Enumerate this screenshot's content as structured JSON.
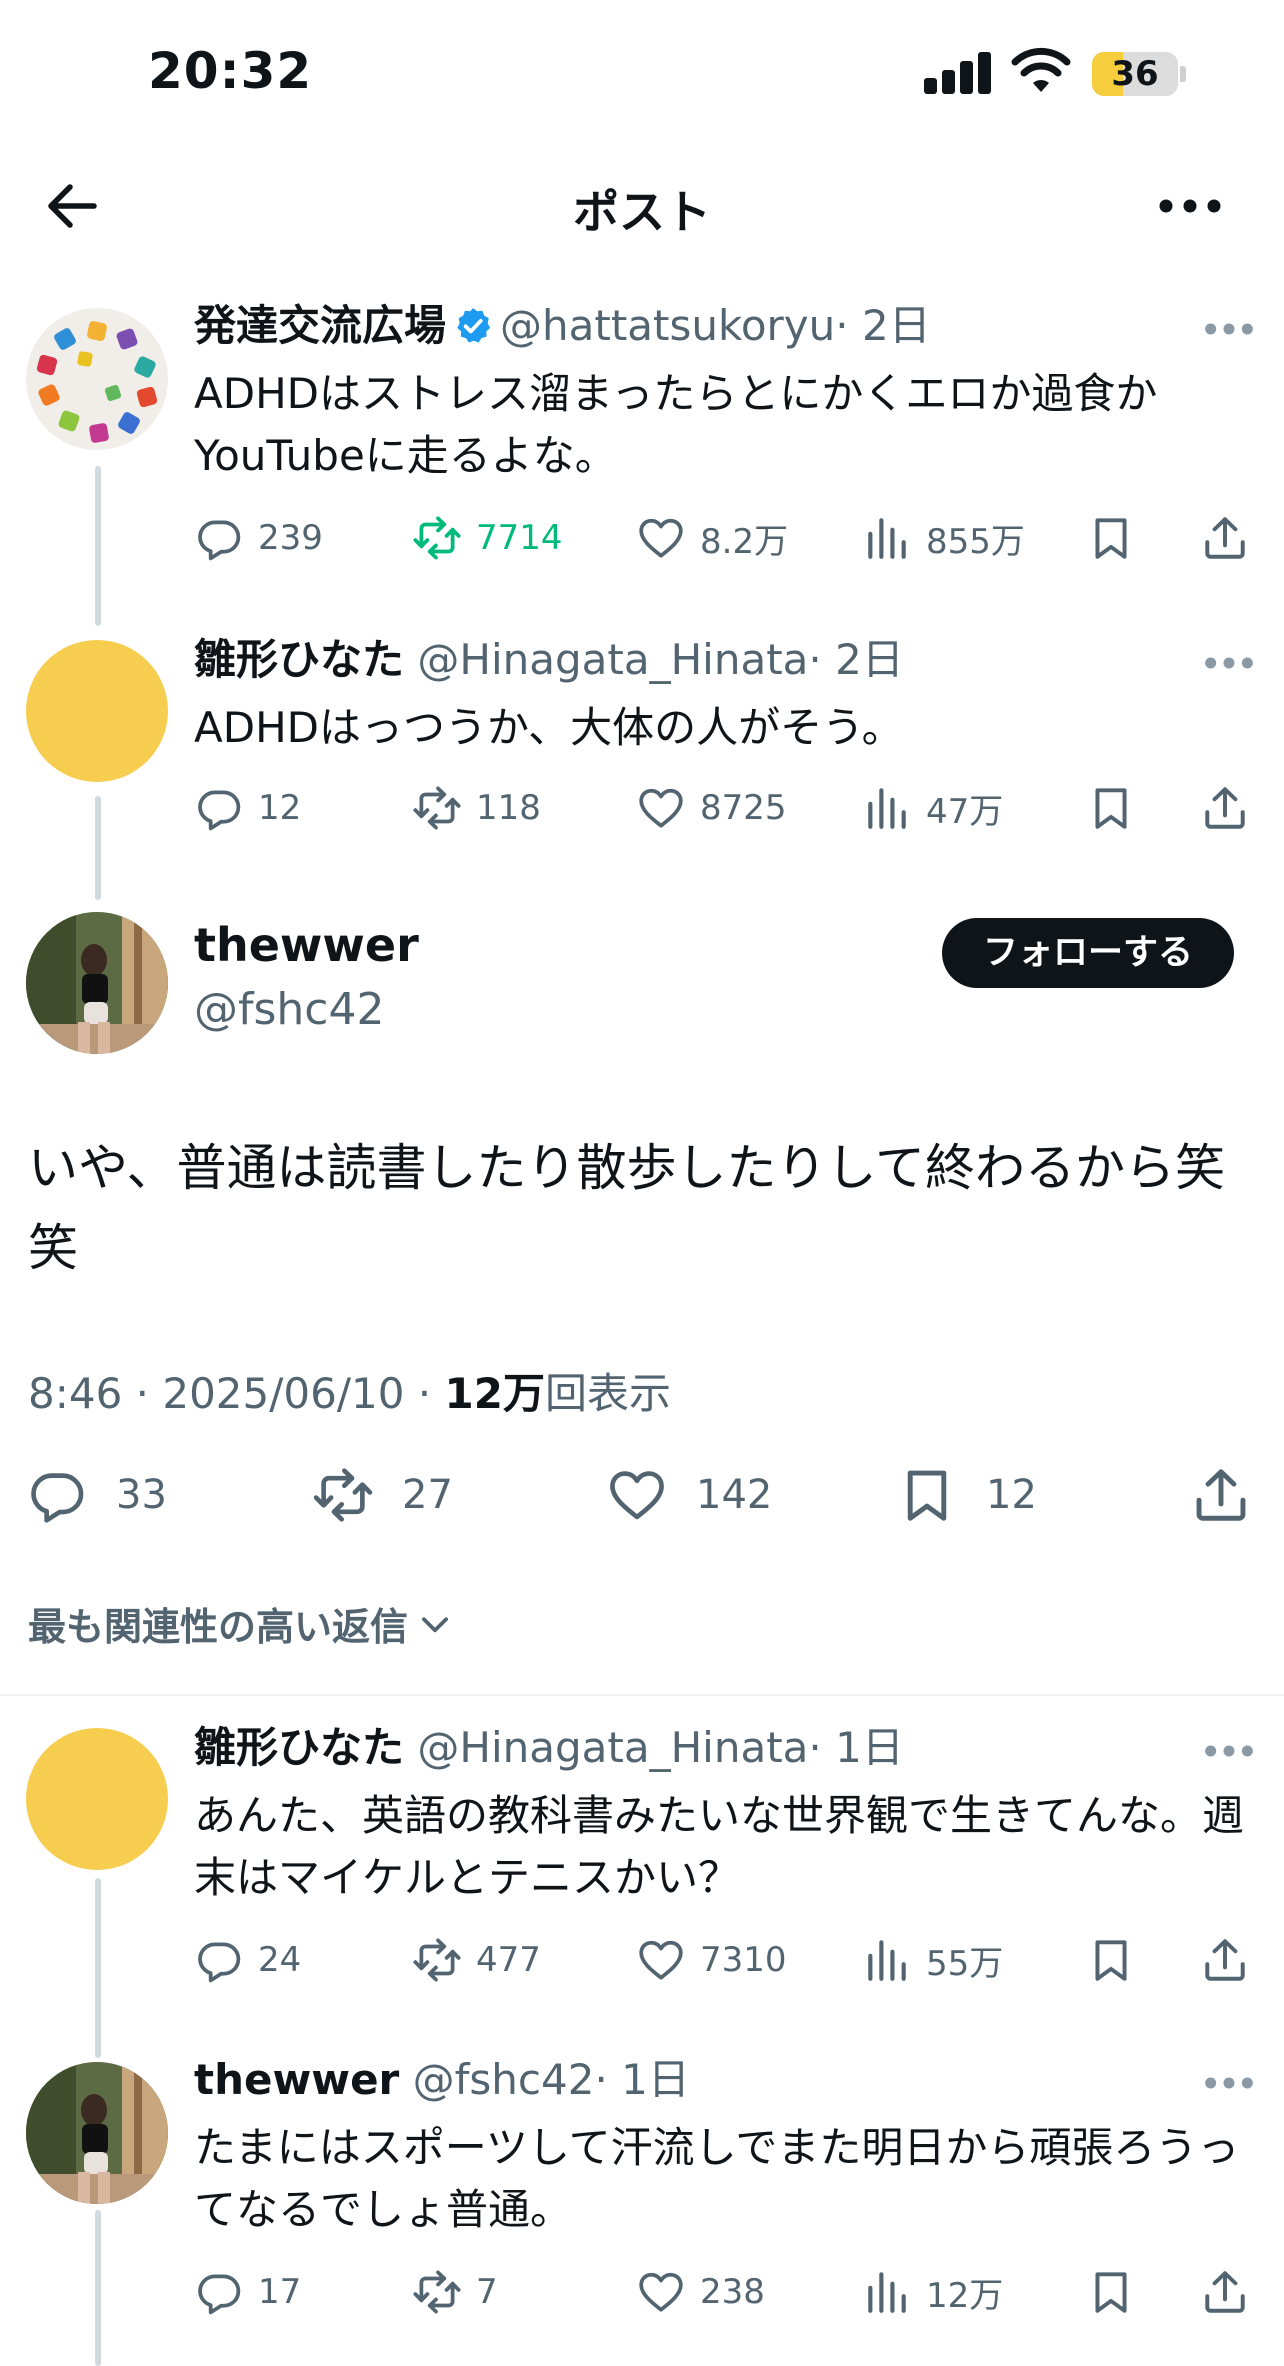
{
  "status_bar": {
    "time": "20:32",
    "battery": "36",
    "battery_level": 0.36
  },
  "nav": {
    "title": "ポスト"
  },
  "posts": [
    {
      "name": "発達交流広場",
      "handle": "@hattatsukoryu",
      "time": "· 2日",
      "text": "ADHDはストレス溜まったらとにかくエロか過食かYouTubeに走るよな。",
      "replies": "239",
      "reposts": "7714",
      "likes": "8.2万",
      "views": "855万"
    },
    {
      "name": "雛形ひなた",
      "handle": "@Hinagata_Hinata",
      "time": "· 2日",
      "text": "ADHDはっつうか、大体の人がそう。",
      "replies": "12",
      "reposts": "118",
      "likes": "8725",
      "views": "47万"
    }
  ],
  "main_post": {
    "name": "thewwer",
    "handle": "@fshc42",
    "follow_label": "フォローする",
    "text": "いや、普通は読書したり散歩したりして終わるから笑笑",
    "meta_time": "8:46 · 2025/06/10 · ",
    "meta_views": "12万",
    "meta_views_label": "回表示",
    "replies": "33",
    "reposts": "27",
    "likes": "142",
    "bookmarks": "12"
  },
  "sort_label": "最も関連性の高い返信",
  "replies": [
    {
      "name": "雛形ひなた",
      "handle": "@Hinagata_Hinata",
      "time": "· 1日",
      "text": "あんた、英語の教科書みたいな世界観で生きてんな。週末はマイケルとテニスかい？",
      "replies": "24",
      "reposts": "477",
      "likes": "7310",
      "views": "55万"
    },
    {
      "name": "thewwer",
      "handle": "@fshc42",
      "time": "· 1日",
      "text": "たまにはスポーツして汗流しでまた明日から頑張ろうってなるでしょ普通。",
      "replies": "17",
      "reposts": "7",
      "likes": "238",
      "views": "12万"
    }
  ],
  "colors": {
    "text": "#0f1419",
    "secondary": "#536471",
    "repost_active": "#00ba7c",
    "verified": "#1d9bf0",
    "avatar_yellow": "#f6cd4f",
    "battery": "#f5cd3d"
  },
  "icons": [
    "back-arrow-icon",
    "more-icon",
    "reply-icon",
    "repost-icon",
    "like-icon",
    "views-icon",
    "bookmark-icon",
    "share-icon",
    "verified-badge-icon",
    "chevron-down-icon",
    "signal-icon",
    "wifi-icon",
    "battery-icon"
  ]
}
